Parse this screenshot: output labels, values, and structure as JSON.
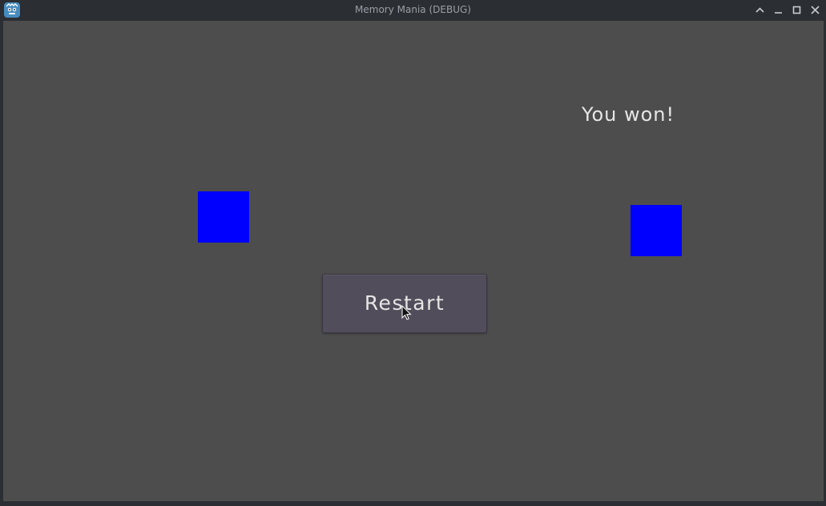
{
  "window": {
    "title": "Memory Mania (DEBUG)",
    "icon": "godot-icon",
    "controls": {
      "keep_above": "chevron-up-icon",
      "minimize": "minimize-icon",
      "maximize": "maximize-icon",
      "close": "close-icon"
    }
  },
  "game": {
    "status_text": "You won!",
    "restart_label": "Restart",
    "card_color": "#0000ff",
    "background_color": "#4d4d4d",
    "cards": [
      {
        "state": "matched"
      },
      {
        "state": "matched"
      }
    ]
  }
}
